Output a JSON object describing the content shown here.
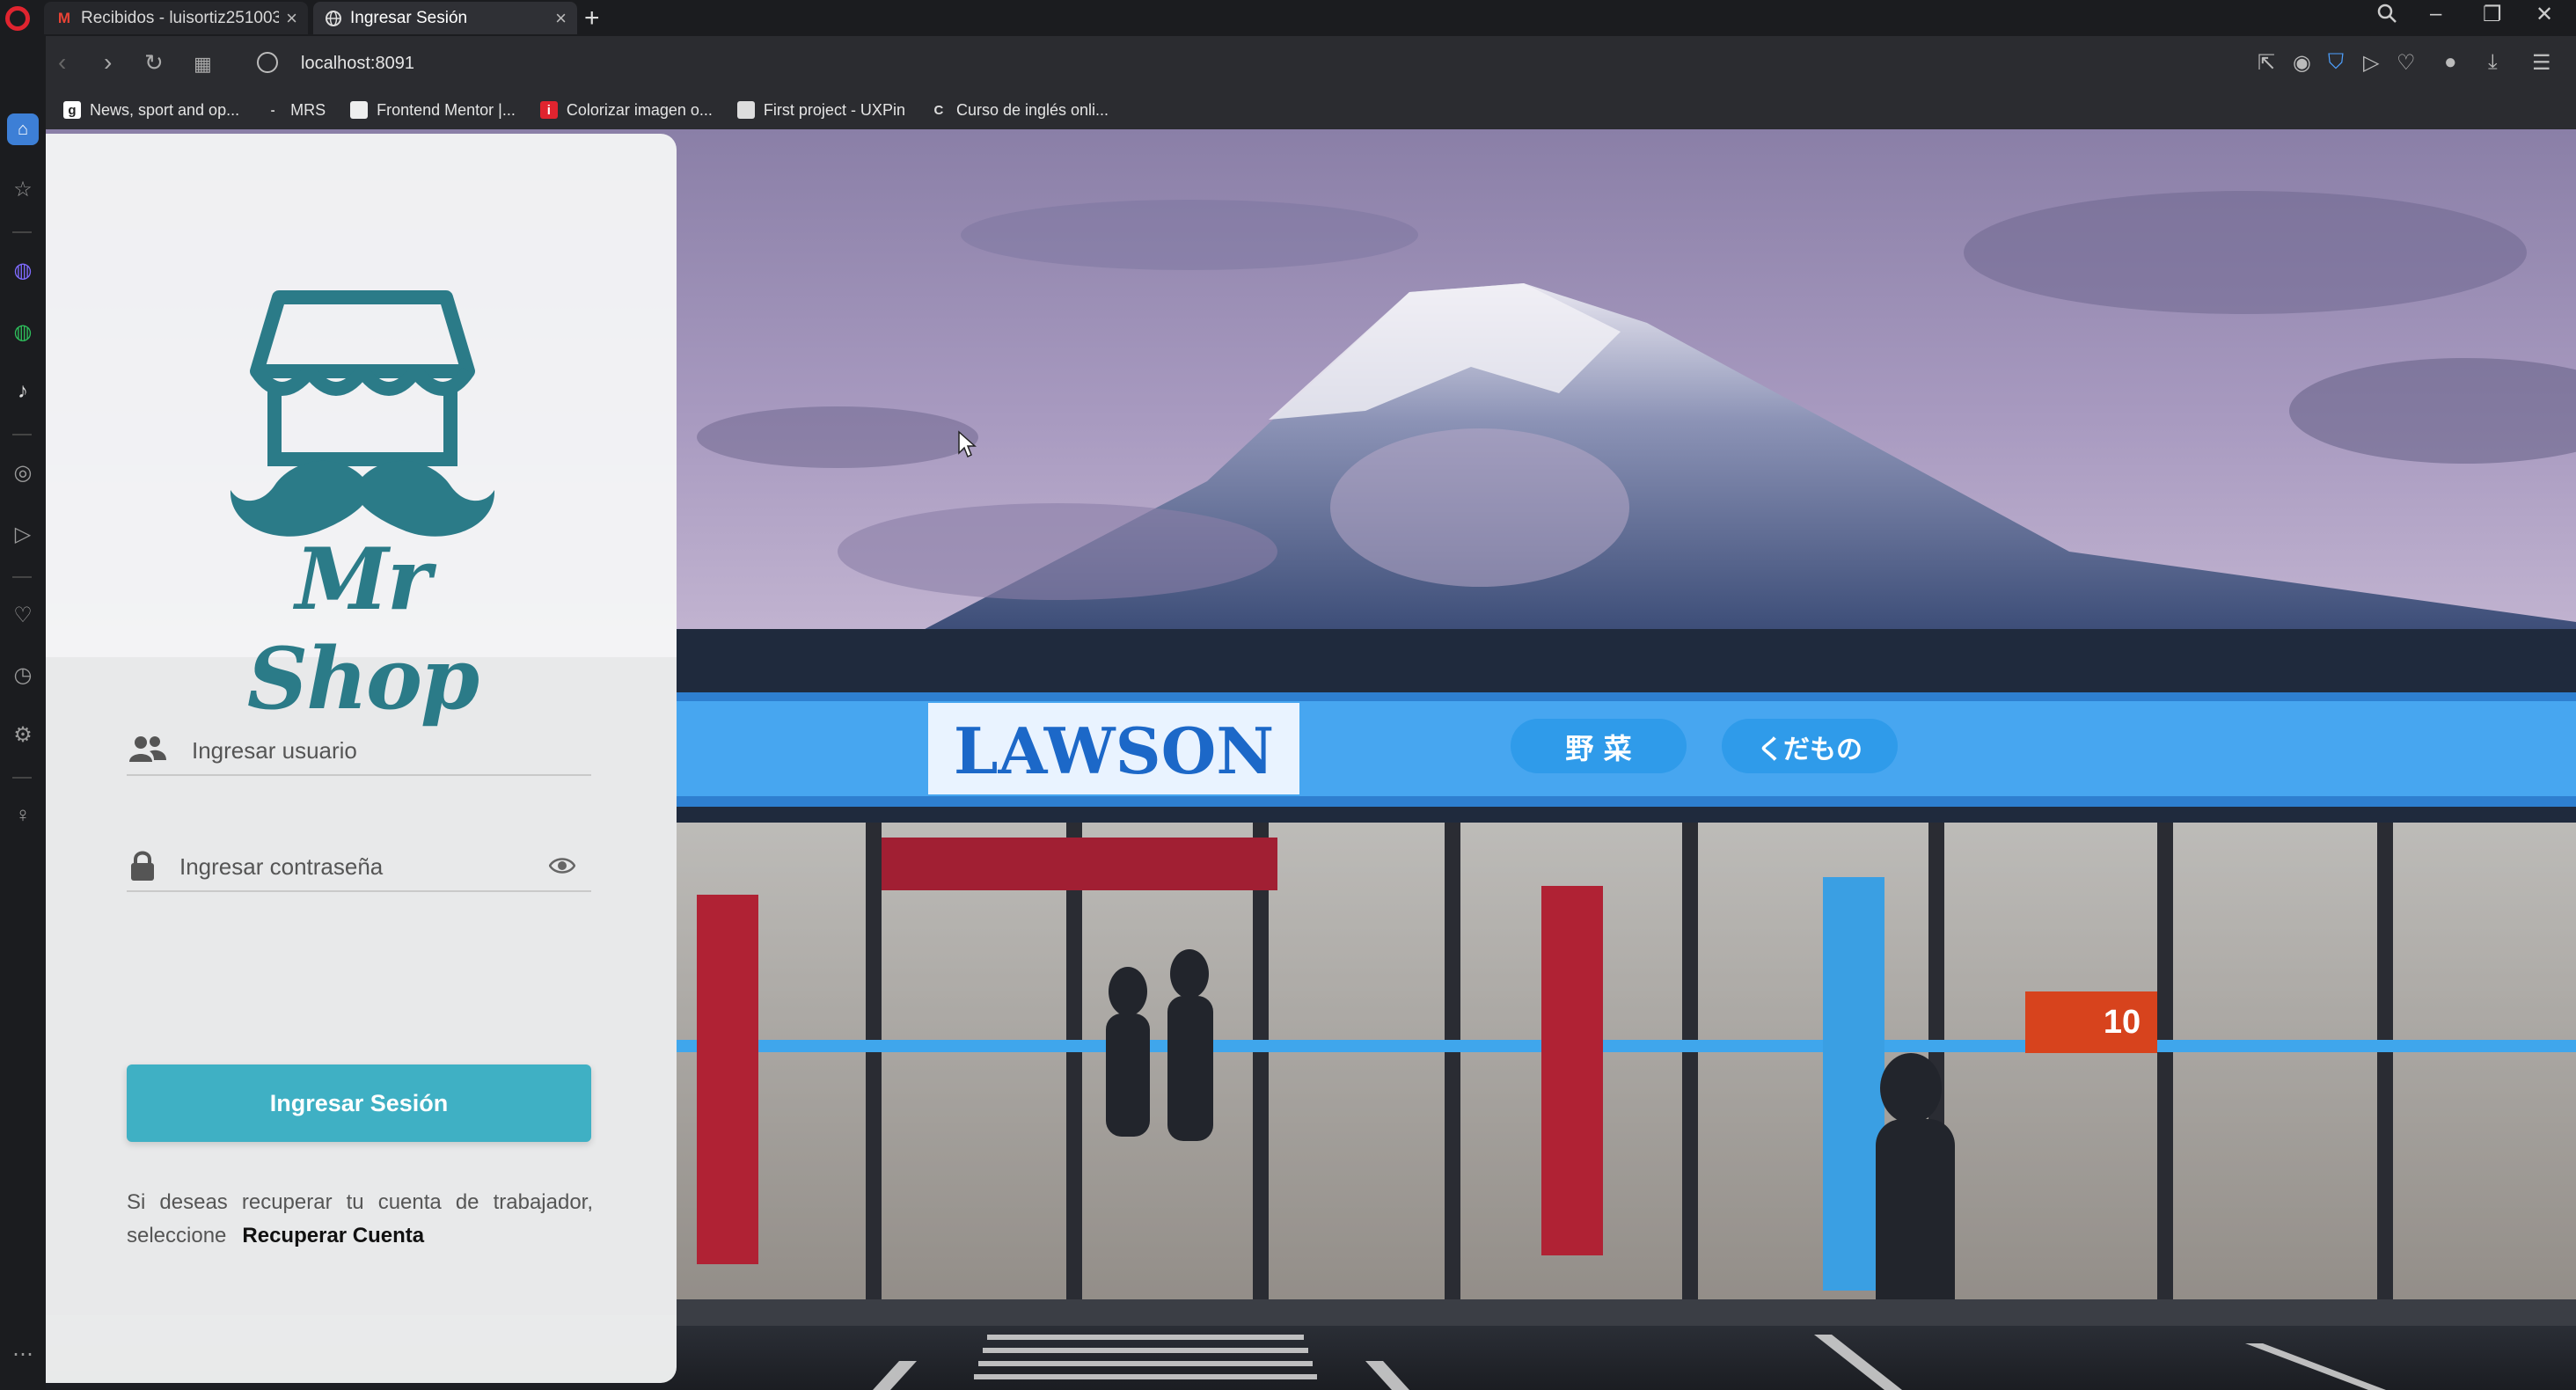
{
  "browser": {
    "tabs": [
      {
        "label": "Recibidos - luisortiz251003",
        "icon": "gmail-icon"
      },
      {
        "label": "Ingresar Sesión",
        "icon": "globe-icon"
      }
    ],
    "address": "localhost:8091",
    "bookmarks": [
      {
        "label": "News, sport and op...",
        "icon": "g"
      },
      {
        "label": "MRS",
        "icon": "-"
      },
      {
        "label": "Frontend Mentor |...",
        "icon": ""
      },
      {
        "label": "Colorizar imagen o...",
        "icon": "i"
      },
      {
        "label": "First project - UXPin",
        "icon": ""
      },
      {
        "label": "Curso de inglés onli...",
        "icon": "C"
      }
    ]
  },
  "login": {
    "brand": "Mr Shop",
    "username_placeholder": "Ingresar usuario",
    "password_placeholder": "Ingresar contraseña",
    "submit_label": "Ingresar Sesión",
    "recover_text": "Si deseas recuperar tu cuenta de trabajador, seleccione",
    "recover_link": "Recuperar Cuenta"
  },
  "background": {
    "store_sign": "LAWSON",
    "sign_veg": "野 菜",
    "sign_fruit": "くだもの",
    "price_tag": "10"
  },
  "colors": {
    "brand_teal": "#2b7b88",
    "button": "#3fb0c4"
  }
}
